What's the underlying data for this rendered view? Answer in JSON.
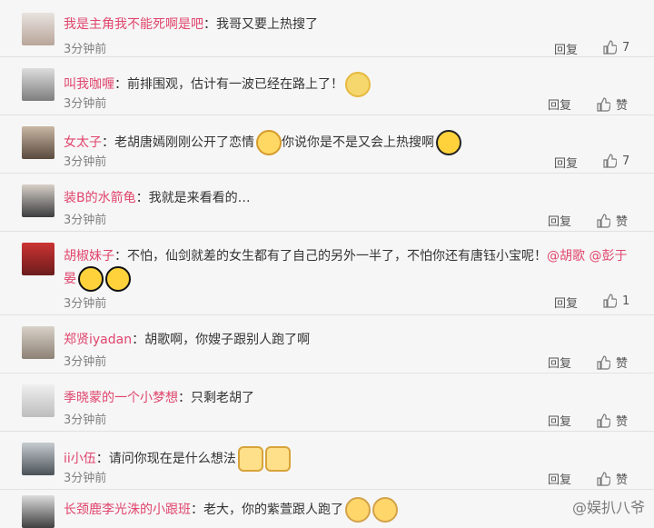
{
  "comments": [
    {
      "user": "我是主角我不能死啊是吧",
      "text": "：我哥又要上热搜了",
      "time": "3分钟前",
      "reply": "回复",
      "like": "7"
    },
    {
      "user": "叫我咖喱",
      "text": "：前排围观，估计有一波已经在路上了！",
      "time": "3分钟前",
      "reply": "回复",
      "like": "赞"
    },
    {
      "user": "女太子",
      "text": "：老胡唐嫣刚刚公开了恋情",
      "text2": "你说你是不是又会上热搜啊",
      "time": "3分钟前",
      "reply": "回复",
      "like": "7"
    },
    {
      "user": "装B的水箭龟",
      "text": "：我就是来看看的…",
      "time": "3分钟前",
      "reply": "回复",
      "like": "赞"
    },
    {
      "user": "胡椒妹子",
      "text": "：不怕，仙剑就差的女生都有了自己的另外一半了，不怕你还有唐钰小宝呢！",
      "mention": "@胡歌 @彭于晏",
      "time": "3分钟前",
      "reply": "回复",
      "like": "1"
    },
    {
      "user": "郑贤iyadan",
      "text": "：胡歌啊，你嫂子跟别人跑了啊",
      "time": "3分钟前",
      "reply": "回复",
      "like": "赞"
    },
    {
      "user": "季晓蒙的一个小梦想",
      "text": "：只剩老胡了",
      "time": "3分钟前",
      "reply": "回复",
      "like": "赞"
    },
    {
      "user": "ii小伍",
      "text": "：请问你现在是什么想法",
      "time": "3分钟前",
      "reply": "回复",
      "like": "赞"
    },
    {
      "user": "长颈鹿李光洙的小跟班",
      "text": "：老大，你的紫萱跟人跑了",
      "time": "",
      "reply": "",
      "like": ""
    }
  ],
  "watermark": "@娱扒八爷",
  "colors": {
    "username": "#e0456c",
    "background": "#f6f6f6"
  }
}
